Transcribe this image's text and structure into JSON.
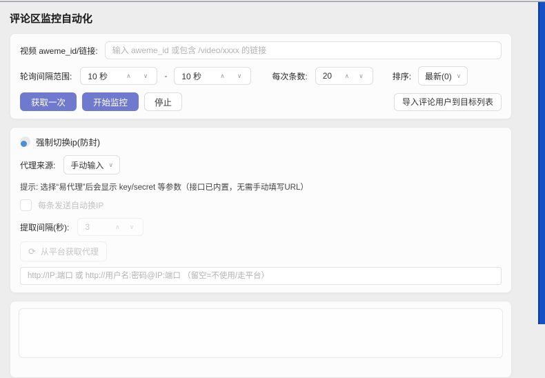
{
  "page": {
    "title": "评论区监控自动化"
  },
  "colors": {
    "primary_button": "#6f7ace",
    "accent_bar": "#1550c4"
  },
  "icons": {
    "chevron_up": "∧",
    "chevron_down": "∨",
    "refresh": "⟳"
  },
  "form": {
    "video_label": "视频 aweme_id/链接:",
    "video_placeholder": "输入 aweme_id 或包含 /video/xxxx 的链接",
    "interval_label": "轮询间隔范围:",
    "interval_min": "10 秒",
    "interval_separator": "-",
    "interval_max": "10 秒",
    "count_label": "每次条数:",
    "count_value": "20",
    "sort_label": "排序:",
    "sort_value": "最新(0)",
    "fetch_once_label": "获取一次",
    "start_monitor_label": "开始监控",
    "stop_label": "停止",
    "import_users_label": "导入评论用户到目标列表"
  },
  "proxy": {
    "title": "强制切换ip(防封)",
    "source_label": "代理来源:",
    "source_value": "手动输入",
    "tip": "提示: 选择“易代理”后会显示 key/secret 等参数（接口已内置，无需手动填写URL）",
    "auto_switch_label": "每条发送自动换IP",
    "extract_interval_label": "提取间隔(秒):",
    "extract_interval_value": "3",
    "fetch_from_platform_label": "从平台获取代理",
    "manual_placeholder": "http://IP:端口 或 http://用户名:密码@IP:端口 （留空=不使用/走平台）"
  }
}
